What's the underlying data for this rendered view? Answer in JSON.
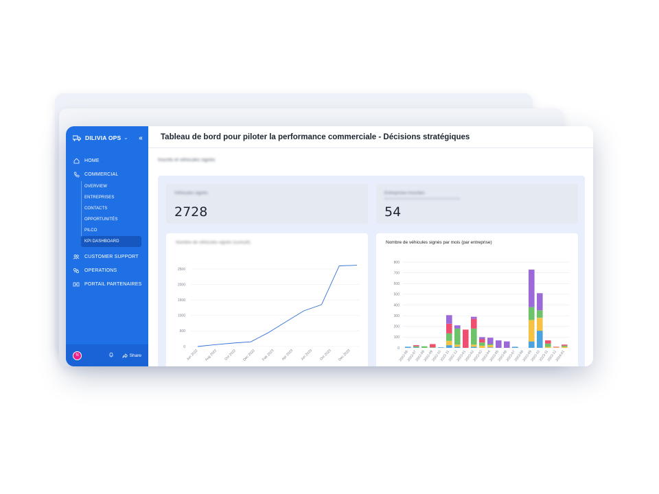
{
  "app": {
    "name": "DILIVIA OPS",
    "collapse_icon": "«"
  },
  "sidebar": {
    "items": [
      {
        "label": "HOME",
        "icon": "home-icon"
      },
      {
        "label": "COMMERCIAL",
        "icon": "phone-icon",
        "children": [
          "OVERVIEW",
          "ENTREPRISES",
          "CONTACTS",
          "OPPORTUNITÉS",
          "PILCO",
          "KPI DASHBOARD"
        ]
      },
      {
        "label": "CUSTOMER SUPPORT",
        "icon": "users-icon"
      },
      {
        "label": "OPERATIONS",
        "icon": "operations-icon"
      },
      {
        "label": "PORTAIL PARTENAIRES",
        "icon": "partners-icon"
      }
    ],
    "active_child": "KPI DASHBOARD",
    "footer": {
      "avatar_initial": "N",
      "share_label": "Share"
    }
  },
  "header": {
    "title": "Tableau de bord pour piloter la performance commerciale - Décisions stratégiques"
  },
  "section": {
    "label": "Inscrits et véhicules signés"
  },
  "kpis": [
    {
      "label": "Véhicules signés",
      "value": "2728"
    },
    {
      "label": "Entreprises inscrites",
      "value": "54"
    }
  ],
  "chart_data": [
    {
      "type": "line",
      "title": "Nombre de véhicules signés (cumulé)",
      "x": [
        "Jun 2022",
        "Aug 2022",
        "Oct 2022",
        "Dec 2022",
        "Feb 2023",
        "Apr 2023",
        "Jun 2023",
        "Oct 2023",
        "Dec 2023"
      ],
      "x_ticks": [
        "Jun 2022",
        "Aug 2022",
        "Oct 2022",
        "Dec 2022",
        "Feb 2023",
        "Apr 2023",
        "Jun 2023",
        "Oct 2023",
        "Dec 2023"
      ],
      "series": [
        {
          "values": [
            0,
            60,
            110,
            150,
            450,
            800,
            1150,
            1350,
            2600,
            2728
          ]
        }
      ],
      "ylim": [
        0,
        2500
      ],
      "y_ticks": [
        0,
        500,
        1000,
        1500,
        2000,
        2500
      ],
      "color": "#2f6fd6"
    },
    {
      "type": "bar",
      "stacked": true,
      "title": "Nombre de véhicules signés par mois (par entreprise)",
      "categories": [
        "2022-06",
        "2022-07",
        "2022-08",
        "2022-09",
        "2022-10",
        "2022-11",
        "2022-12",
        "2023-01",
        "2023-02",
        "2023-03",
        "2023-04",
        "2023-05",
        "2023-06",
        "2023-07",
        "2023-08",
        "2023-09",
        "2023-10",
        "2023-11",
        "2023-12",
        "2024-01"
      ],
      "x_ticks": [
        "2022-06",
        "2022-07",
        "2022-08",
        "2022-09",
        "2022-10",
        "2022-11",
        "2022-12",
        "2023-01",
        "2023-02",
        "2023-03",
        "2023-04",
        "2023-05",
        "2023-06",
        "2023-07",
        "2023-08",
        "2023-09",
        "2023-10",
        "2023-11",
        "2023-12",
        "2024-01"
      ],
      "series": [
        {
          "color": "#4aa3df",
          "values": [
            10,
            5,
            0,
            0,
            5,
            25,
            10,
            0,
            10,
            0,
            5,
            0,
            0,
            10,
            0,
            60,
            160,
            0,
            0,
            0
          ]
        },
        {
          "color": "#f6c244",
          "values": [
            0,
            0,
            0,
            0,
            0,
            40,
            20,
            0,
            20,
            20,
            20,
            0,
            0,
            0,
            0,
            200,
            120,
            10,
            5,
            10
          ]
        },
        {
          "color": "#6cc36a",
          "values": [
            0,
            10,
            15,
            5,
            0,
            70,
            150,
            0,
            150,
            30,
            10,
            0,
            0,
            0,
            0,
            120,
            70,
            30,
            0,
            10
          ]
        },
        {
          "color": "#ef4f6e",
          "values": [
            0,
            10,
            0,
            30,
            0,
            90,
            0,
            170,
            90,
            30,
            0,
            0,
            0,
            0,
            0,
            0,
            0,
            30,
            5,
            10
          ]
        },
        {
          "color": "#9c6ad8",
          "values": [
            0,
            0,
            0,
            0,
            0,
            80,
            30,
            0,
            20,
            20,
            60,
            70,
            60,
            0,
            0,
            350,
            160,
            0,
            0,
            0
          ]
        }
      ],
      "ylim": [
        0,
        800
      ],
      "y_ticks": [
        0,
        100,
        200,
        300,
        400,
        500,
        600,
        700,
        800
      ]
    }
  ]
}
